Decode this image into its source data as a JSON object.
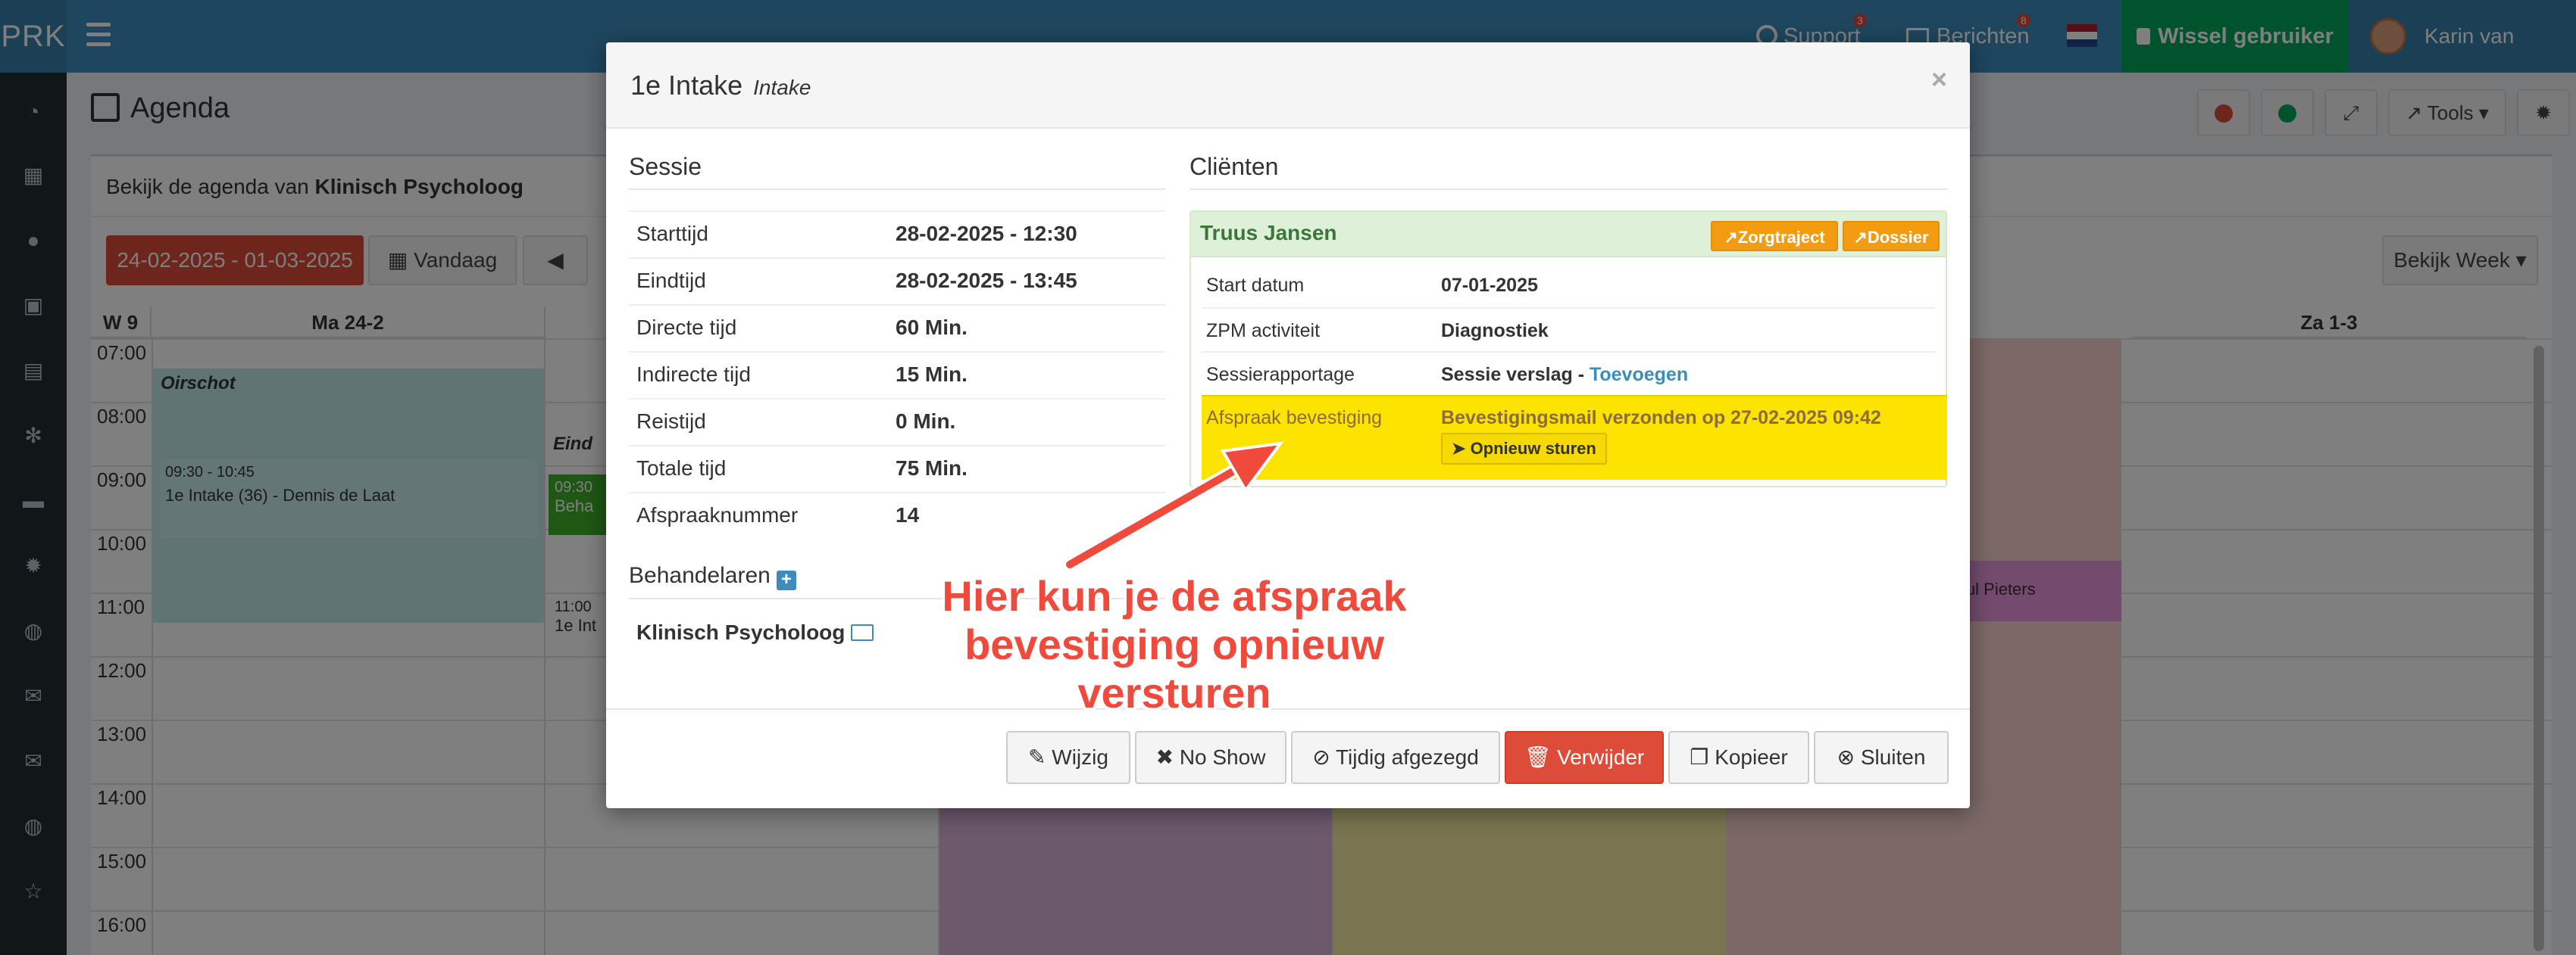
{
  "app": {
    "brand": "PRK"
  },
  "topbar": {
    "support_label": "Support",
    "support_count": "3",
    "messages_label": "Berichten",
    "messages_count": "8",
    "switch_user_label": "Wissel gebruiker",
    "user_name": "Karin van Camp"
  },
  "sidebar": {
    "icons": [
      "dashboard-icon",
      "calendar-icon",
      "user-icon",
      "briefcase-icon",
      "book-icon",
      "cogs-icon",
      "truck-icon",
      "gear-icon",
      "globe-icon",
      "envelope-icon",
      "envelope-icon",
      "globe-icon",
      "star-icon"
    ]
  },
  "page": {
    "title": "Agenda",
    "tools_label": "Tools",
    "agenda_of_prefix": "Bekijk de agenda van",
    "agenda_of_name": "Klinisch Psycholoog",
    "date_range": "24-02-2025 - 01-03-2025",
    "today_label": "Vandaag",
    "view_label": "Bekijk Week"
  },
  "calendar": {
    "week_label": "W 9",
    "days": [
      "Ma 24-2",
      "Za 1-3"
    ],
    "hours": [
      "07:00",
      "08:00",
      "09:00",
      "10:00",
      "11:00",
      "12:00",
      "13:00",
      "14:00",
      "15:00",
      "16:00"
    ],
    "location": "Oirschot",
    "location2": "Eind",
    "event1_time": "09:30 - 10:45",
    "event1_title": "1e Intake (36) - Dennis de Laat",
    "event2_time": "09:30",
    "event2_title": "Beha",
    "event3_time": "11:00",
    "event3_title": "1e Int",
    "event4_title": "Paul Pieters"
  },
  "modal": {
    "title": "1e Intake",
    "subtitle": "Intake",
    "session_title": "Sessie",
    "session_rows": [
      {
        "label": "Starttijd",
        "value": "28-02-2025 - 12:30"
      },
      {
        "label": "Eindtijd",
        "value": "28-02-2025 - 13:45"
      },
      {
        "label": "Directe tijd",
        "value": "60 Min."
      },
      {
        "label": "Indirecte tijd",
        "value": "15 Min."
      },
      {
        "label": "Reistijd",
        "value": "0 Min."
      },
      {
        "label": "Totale tijd",
        "value": "75 Min."
      },
      {
        "label": "Afspraaknummer",
        "value": "14"
      }
    ],
    "clients_title": "Cliënten",
    "client_name": "Truus Jansen",
    "care_path_label": "Zorgtraject",
    "dossier_label": "Dossier",
    "client_rows": [
      {
        "label": "Start datum",
        "value": "07-01-2025"
      },
      {
        "label": "ZPM activiteit",
        "value": "Diagnostiek"
      },
      {
        "label": "Sessierapportage",
        "value": "Sessie verslag -",
        "link": "Toevoegen"
      }
    ],
    "confirmation_label": "Afspraak bevestiging",
    "confirmation_value": "Bevestigingsmail verzonden op 27-02-2025 09:42",
    "resend_label": "Opnieuw sturen",
    "practitioners_title": "Behandelaren",
    "practitioner_name": "Klinisch Psycholoog",
    "buttons": {
      "edit": "Wijzig",
      "no_show": "No Show",
      "cancelled": "Tijdig afgezegd",
      "delete": "Verwijder",
      "copy": "Kopieer",
      "close": "Sluiten"
    }
  },
  "annotation": {
    "line1": "Hier kun je de afspraak",
    "line2": "bevestiging opnieuw versturen"
  },
  "colors": {
    "primary": "#3c8dbc",
    "danger": "#dd4b39",
    "success": "#00a65a",
    "warning": "#f39c12",
    "highlight": "#fde300",
    "annotation": "#f04a3c"
  }
}
